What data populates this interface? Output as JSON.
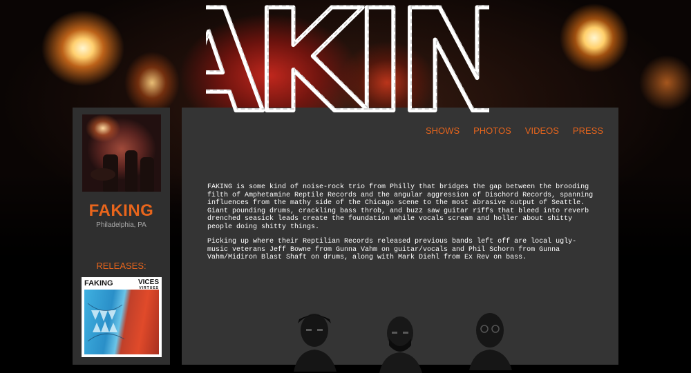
{
  "header": {
    "logo_text": "FAKING"
  },
  "nav": {
    "items": [
      {
        "label": "SHOWS"
      },
      {
        "label": "PHOTOS"
      },
      {
        "label": "VIDEOS"
      },
      {
        "label": "PRESS"
      }
    ],
    "color": "#e8651c"
  },
  "sidebar": {
    "band_name": "FAKING",
    "location": "Philadelphia, PA",
    "releases_label": "RELEASES:",
    "release": {
      "title": "FAKING",
      "subtitle": "VICES",
      "subtitle_small": "VIRTUES"
    }
  },
  "main": {
    "bio_paragraphs": [
      "FAKING is some kind of noise-rock trio from Philly that bridges the gap between the brooding filth of Amphetamine Reptile Records and the angular aggression of Dischord Records, spanning influences from the mathy side of the Chicago scene to the most abrasive output of Seattle. Giant pounding drums, crackling bass throb, and buzz saw guitar riffs that bleed into reverb drenched seasick leads create the foundation while vocals scream and holler about shitty people doing shitty things.",
      "Picking up where their Reptilian Records released previous bands left off are local ugly-music veterans Jeff Bowne from Gunna Vahm on guitar/vocals and Phil Schorn from Gunna Vahm/Midiron Blast Shaft on drums, along with Mark Diehl from Ex Rev on bass."
    ]
  },
  "colors": {
    "accent": "#e8651c",
    "panel": "#343434",
    "sidebar": "#2f2f2f"
  }
}
